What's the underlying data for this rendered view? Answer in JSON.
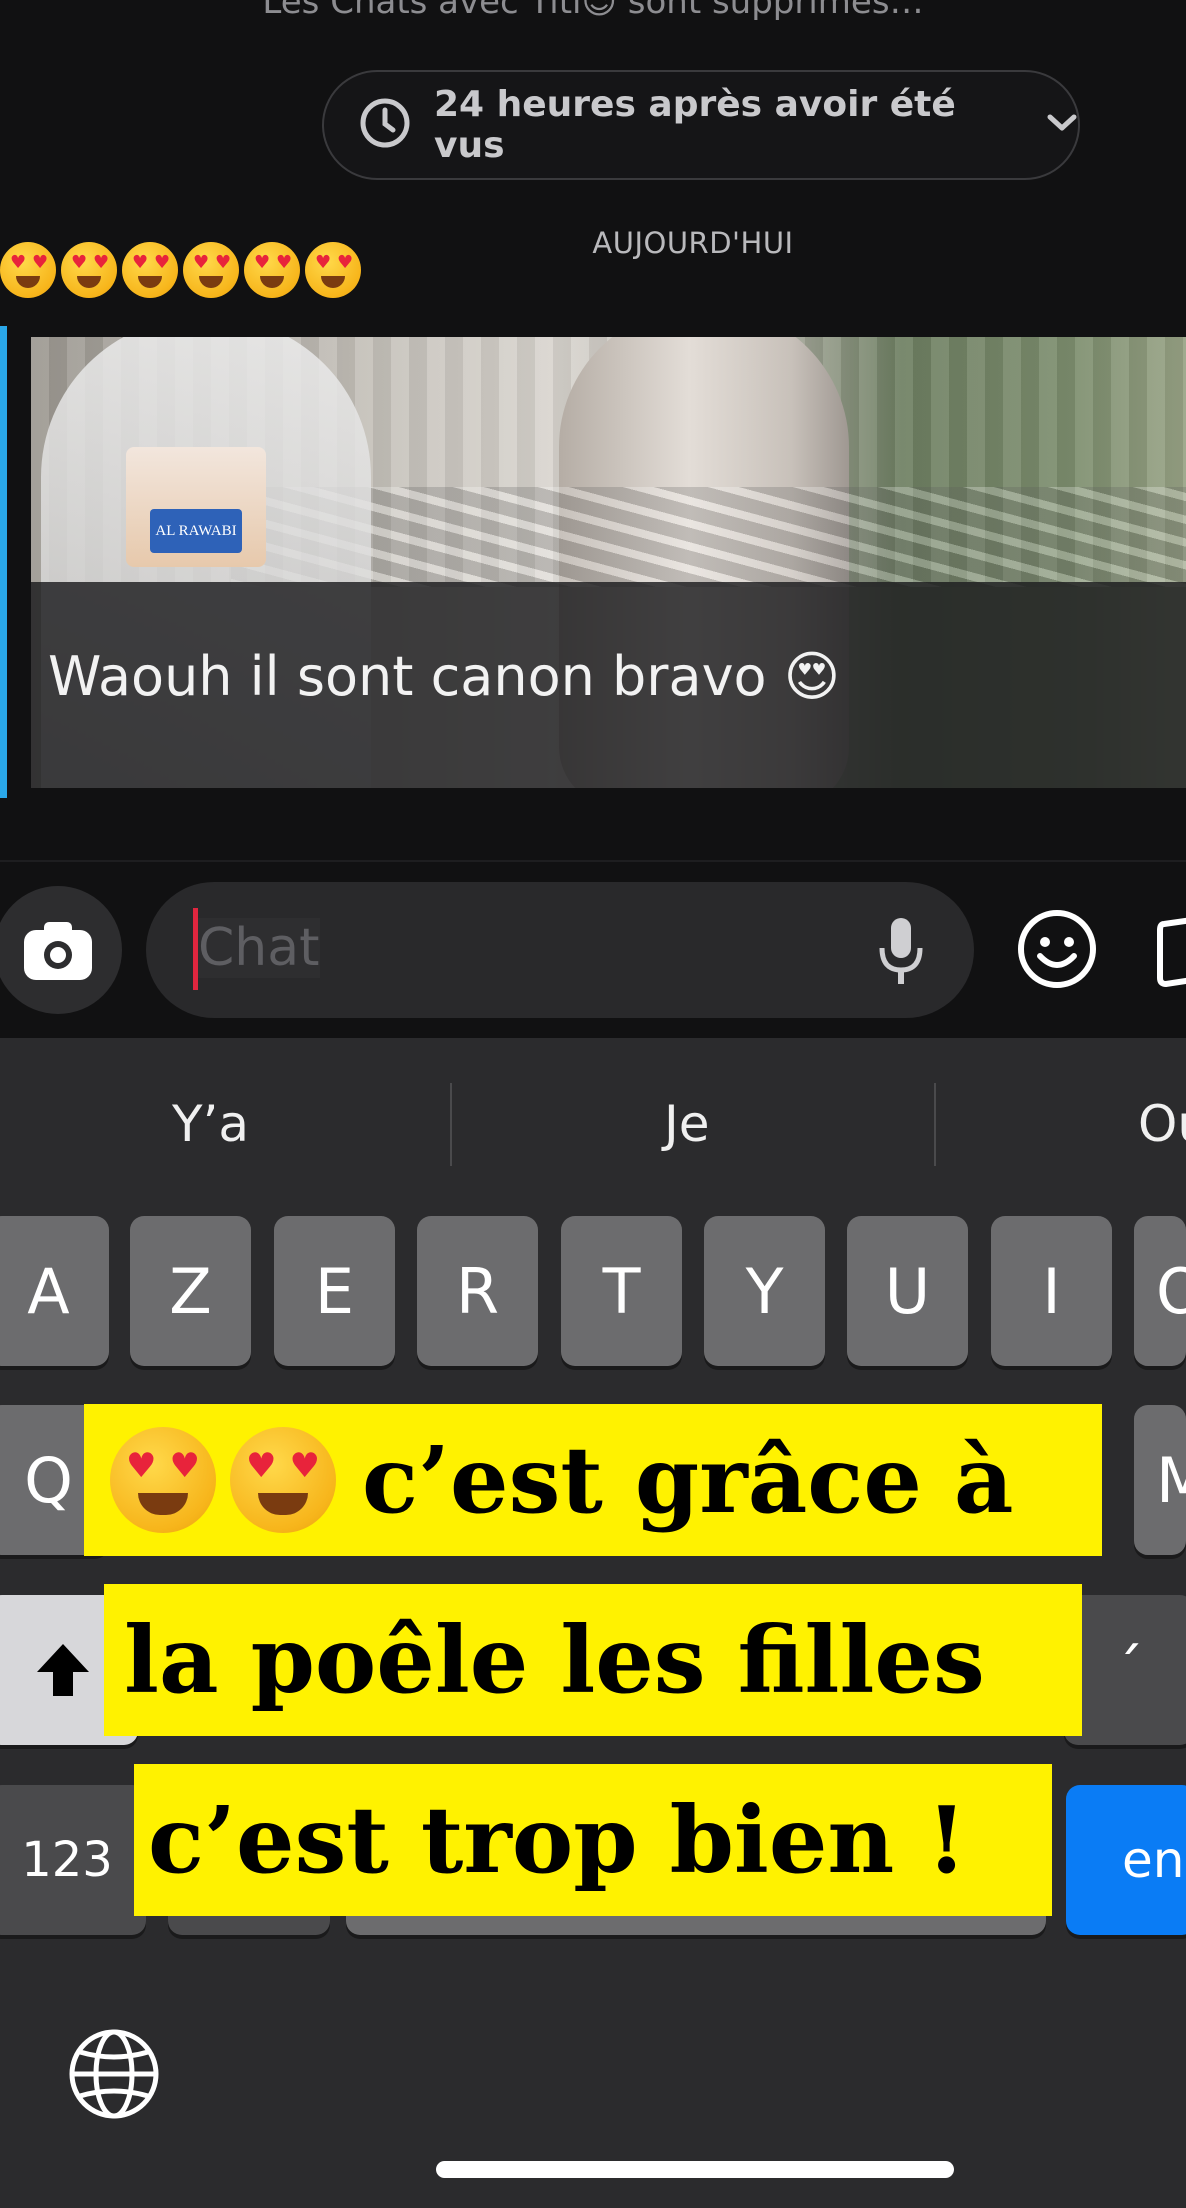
{
  "chat": {
    "notice": "Les Chats avec Titi😉 sont supprimés…",
    "timer_label": "24 heures après avoir été vus",
    "date_separator": "AUJOURD'HUI",
    "emoji_message": "😍😍😍😍😍😍",
    "story_brand": "AL RAWABI",
    "story_reply_caption": "Waouh il sont canon bravo 😍"
  },
  "input": {
    "placeholder": "Chat"
  },
  "keyboard": {
    "suggestions": [
      "Y’a",
      "Je",
      "Ou"
    ],
    "row1": [
      "A",
      "Z",
      "E",
      "R",
      "T",
      "Y",
      "U",
      "I",
      "O"
    ],
    "row2_first": "Q",
    "row2_last": "M",
    "accent_key": "´",
    "num_key": "123",
    "enter_key": "en"
  },
  "overlay_caption": {
    "line1": "c’est grâce à",
    "line2": "la poêle les filles",
    "line3": "c’est trop bien !"
  },
  "colors": {
    "background": "#111112",
    "reply_bar": "#2aa7e8",
    "caret": "#e0263f",
    "caption_bg": "#fff200",
    "enter_key": "#0a7cf5"
  }
}
